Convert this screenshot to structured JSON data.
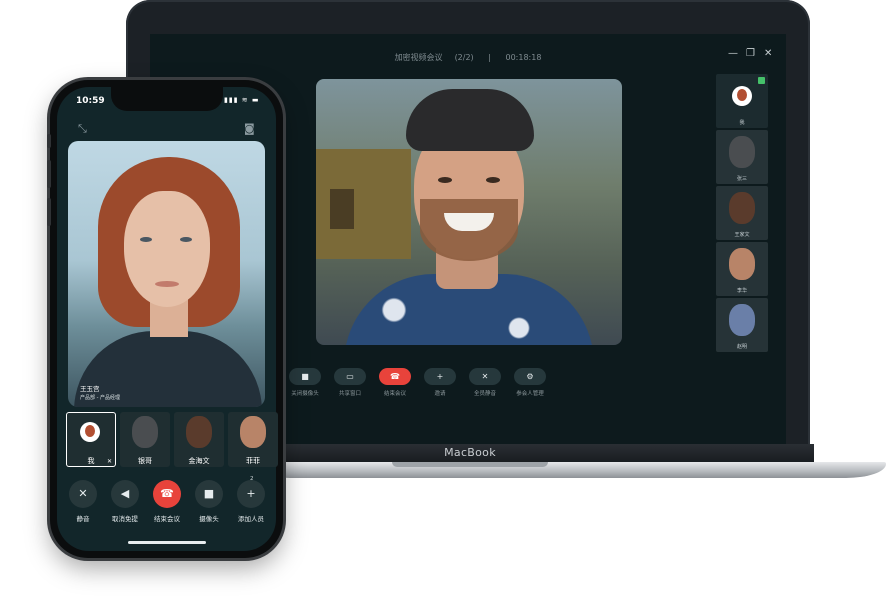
{
  "laptop": {
    "brand": "MacBook",
    "window": {
      "title": "加密视频会议",
      "count": "(2/2)",
      "separator": "|",
      "timer": "00:18:18",
      "minimize": "—",
      "restore": "❐",
      "close": "✕"
    },
    "participants": [
      {
        "name": "我",
        "kind": "avatar"
      },
      {
        "name": "张三",
        "kind": "photo",
        "tone": "#4a4d50"
      },
      {
        "name": "王家文",
        "kind": "photo",
        "tone": "#5a3b2c"
      },
      {
        "name": "李华",
        "kind": "photo",
        "tone": "#b88468"
      },
      {
        "name": "赵明",
        "kind": "photo",
        "tone": "#6a7fa8"
      }
    ],
    "toolbar": [
      {
        "label": "关闭摄像头",
        "icon": "■"
      },
      {
        "label": "共享窗口",
        "icon": "▭"
      },
      {
        "label": "结束会议",
        "icon": "☎",
        "danger": true
      },
      {
        "label": "邀请",
        "icon": "+"
      },
      {
        "label": "全员静音",
        "icon": "✕"
      },
      {
        "label": "参会人管理",
        "icon": "⚙"
      }
    ]
  },
  "phone": {
    "status": {
      "time": "10:59",
      "icons": "▮▮▮ ≋ ▬"
    },
    "top_icons": {
      "left": "⤡",
      "right": "◙"
    },
    "speaker": {
      "name": "王玉宫",
      "role": "产品部 - 产品经理"
    },
    "thumbs": [
      {
        "name": "我",
        "kind": "avatar",
        "mic": "✕"
      },
      {
        "name": "银哥",
        "kind": "photo",
        "tone": "#4a4d50"
      },
      {
        "name": "金海文",
        "kind": "photo",
        "tone": "#5a3b2c"
      },
      {
        "name": "菲菲",
        "kind": "photo",
        "tone": "#b88468"
      }
    ],
    "controls": [
      {
        "label": "静音",
        "icon": "✕"
      },
      {
        "label": "取消免提",
        "icon": "◀"
      },
      {
        "label": "结束会议",
        "icon": "☎",
        "danger": true
      },
      {
        "label": "摄像头",
        "icon": "■"
      },
      {
        "label": "添加人员",
        "icon": "+",
        "badge": "2"
      }
    ]
  }
}
